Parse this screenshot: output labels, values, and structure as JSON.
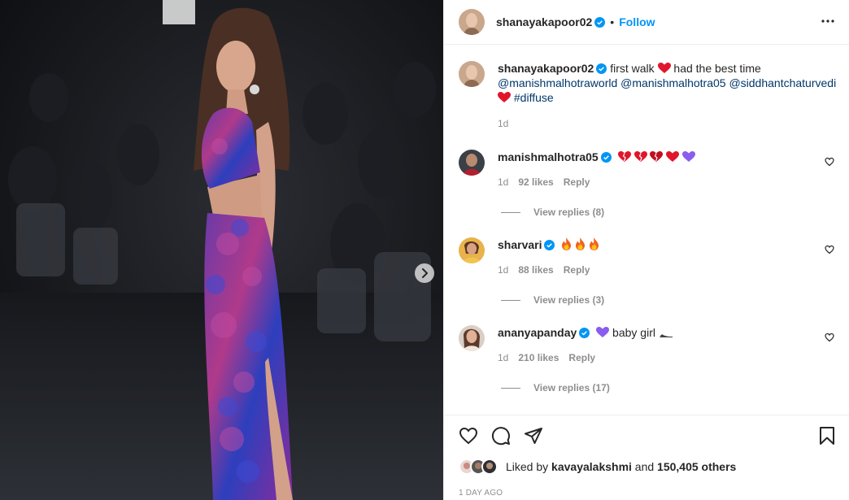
{
  "post": {
    "author": "shanayakapoor02",
    "follow_label": "Follow",
    "dot": "•",
    "caption_text": "first walk",
    "caption_text2": "had the best time",
    "mentions": [
      "@manishmalhotraworld",
      "@manishmalhotra05",
      "@siddhantchaturvedi"
    ],
    "hashtag": "#diffuse",
    "time": "1d"
  },
  "comments": [
    {
      "user": "manishmalhotra05",
      "text": "",
      "time": "1d",
      "likes": "92 likes",
      "reply": "Reply",
      "view_replies": "View replies (8)",
      "emojis": [
        "broken-heart",
        "broken-heart",
        "broken-heart",
        "red-heart",
        "purple-heart"
      ]
    },
    {
      "user": "sharvari",
      "text": "",
      "time": "1d",
      "likes": "88 likes",
      "reply": "Reply",
      "view_replies": "View replies (3)",
      "emojis": [
        "fire",
        "fire",
        "fire"
      ]
    },
    {
      "user": "ananyapanday",
      "text": "baby girl",
      "time": "1d",
      "likes": "210 likes",
      "reply": "Reply",
      "view_replies": "View replies (17)",
      "emojis": [
        "purple-heart"
      ]
    }
  ],
  "footer": {
    "liked_by_prefix": "Liked by",
    "liked_by_user": "kavayalakshmi",
    "and_text": "and",
    "others": "150,405 others",
    "ago": "1 day ago"
  },
  "colors": {
    "link": "#0095f6",
    "mention": "#00376b",
    "muted": "#8e8e8e",
    "heart": "#ed4956",
    "verified": "#0095f6"
  }
}
